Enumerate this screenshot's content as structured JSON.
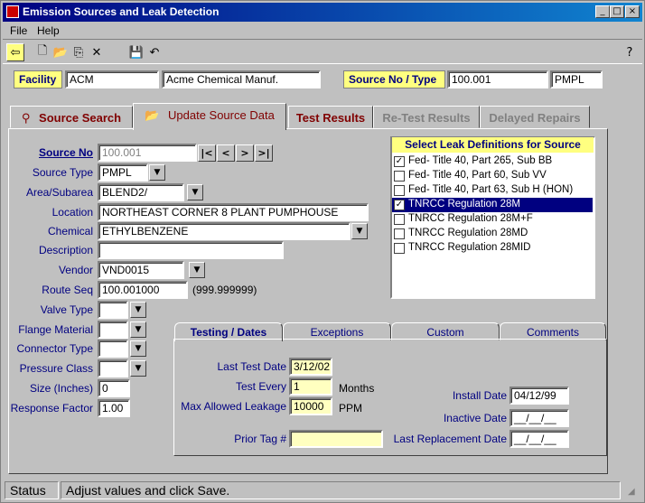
{
  "window": {
    "title": "Emission Sources and Leak Detection",
    "min": "_",
    "max": "□",
    "close": "×"
  },
  "menu": {
    "file": "File",
    "help": "Help"
  },
  "header": {
    "facility_label": "Facility",
    "facility_code": "ACM",
    "facility_name": "Acme Chemical Manuf.",
    "source_label": "Source No / Type",
    "source_no": "100.001",
    "source_type": "PMPL"
  },
  "tabs": {
    "source_search": "Source Search",
    "update_source": "Update Source Data",
    "test_results": "Test Results",
    "retest_results": "Re-Test Results",
    "delayed_repairs": "Delayed Repairs"
  },
  "form": {
    "source_no_label": "Source No",
    "source_no": "100.001",
    "nav_first": "|<",
    "nav_prev": "<",
    "nav_next": ">",
    "nav_last": ">|",
    "source_type_label": "Source Type",
    "source_type": "PMPL",
    "area_label": "Area/Subarea",
    "area": "BLEND2/",
    "location_label": "Location",
    "location": "NORTHEAST CORNER 8 PLANT PUMPHOUSE",
    "chemical_label": "Chemical",
    "chemical": "ETHYLBENZENE",
    "description_label": "Description",
    "description": "",
    "vendor_label": "Vendor",
    "vendor": "VND0015",
    "route_seq_label": "Route Seq",
    "route_seq": "100.001000",
    "route_seq_hint": "(999.999999)",
    "valve_type_label": "Valve Type",
    "flange_label": "Flange Material",
    "connector_label": "Connector Type",
    "pressure_label": "Pressure Class",
    "size_label": "Size (Inches)",
    "size": "0",
    "response_label": "Response Factor",
    "response": "1.00"
  },
  "leak_defs": {
    "title": "Select Leak Definitions for Source",
    "items": [
      {
        "label": "Fed- Title 40, Part 265, Sub BB",
        "checked": "✓"
      },
      {
        "label": "Fed- Title 40, Part 60, Sub VV",
        "checked": ""
      },
      {
        "label": "Fed- Title 40, Part 63, Sub H (HON)",
        "checked": ""
      },
      {
        "label": "TNRCC Regulation 28M",
        "checked": "✓"
      },
      {
        "label": "TNRCC Regulation 28M+F",
        "checked": ""
      },
      {
        "label": "TNRCC Regulation 28MD",
        "checked": ""
      },
      {
        "label": "TNRCC Regulation 28MID",
        "checked": ""
      }
    ]
  },
  "subtabs": {
    "testing": "Testing / Dates",
    "exceptions": "Exceptions",
    "custom": "Custom",
    "comments": "Comments"
  },
  "testing": {
    "last_test_label": "Last Test Date",
    "last_test": "3/12/02",
    "test_every_label": "Test Every",
    "test_every": "1",
    "months": "Months",
    "max_leak_label": "Max Allowed Leakage",
    "max_leak": "10000",
    "ppm": "PPM",
    "prior_tag_label": "Prior Tag #",
    "prior_tag": "",
    "install_label": "Install Date",
    "install": "04/12/99",
    "inactive_label": "Inactive Date",
    "inactive": "__/__/__",
    "replacement_label": "Last Replacement Date",
    "replacement": "__/__/__"
  },
  "status": {
    "label": "Status",
    "message": "Adjust values and click Save."
  }
}
